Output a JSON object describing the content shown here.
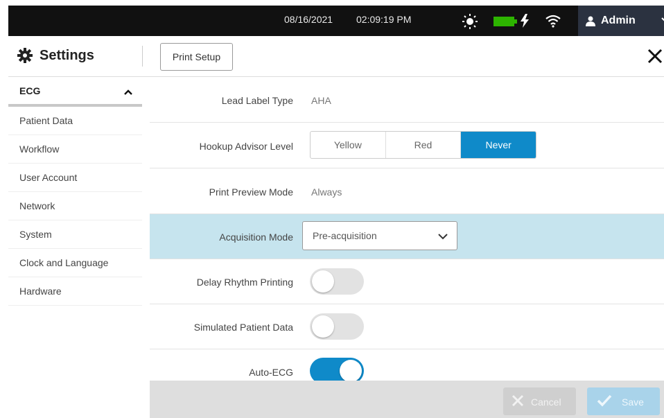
{
  "status_bar": {
    "date": "08/16/2021",
    "time": "02:09:19 PM",
    "user_label": "Admin",
    "battery_color": "#2db400"
  },
  "header": {
    "title": "Settings",
    "print_setup_label": "Print Setup"
  },
  "sidebar": {
    "section_label": "ECG",
    "items": [
      {
        "label": "Patient Data"
      },
      {
        "label": "Workflow"
      },
      {
        "label": "User Account"
      },
      {
        "label": "Network"
      },
      {
        "label": "System"
      },
      {
        "label": "Clock and Language"
      },
      {
        "label": "Hardware"
      }
    ]
  },
  "settings": {
    "lead_label_type": {
      "label": "Lead Label Type",
      "value": "AHA"
    },
    "hookup_advisor": {
      "label": "Hookup Advisor Level",
      "options": [
        "Yellow",
        "Red",
        "Never"
      ],
      "selected": "Never"
    },
    "print_preview": {
      "label": "Print Preview Mode",
      "value": "Always"
    },
    "acquisition_mode": {
      "label": "Acquisition Mode",
      "value": "Pre-acquisition"
    },
    "delay_rhythm": {
      "label": "Delay Rhythm Printing",
      "on": false
    },
    "simulated_patient": {
      "label": "Simulated Patient Data",
      "on": false
    },
    "auto_ecg": {
      "label": "Auto-ECG",
      "on": true
    }
  },
  "footer": {
    "cancel_label": "Cancel",
    "save_label": "Save"
  },
  "colors": {
    "accent": "#0f8ac9",
    "highlight_row": "#c6e4ee"
  }
}
